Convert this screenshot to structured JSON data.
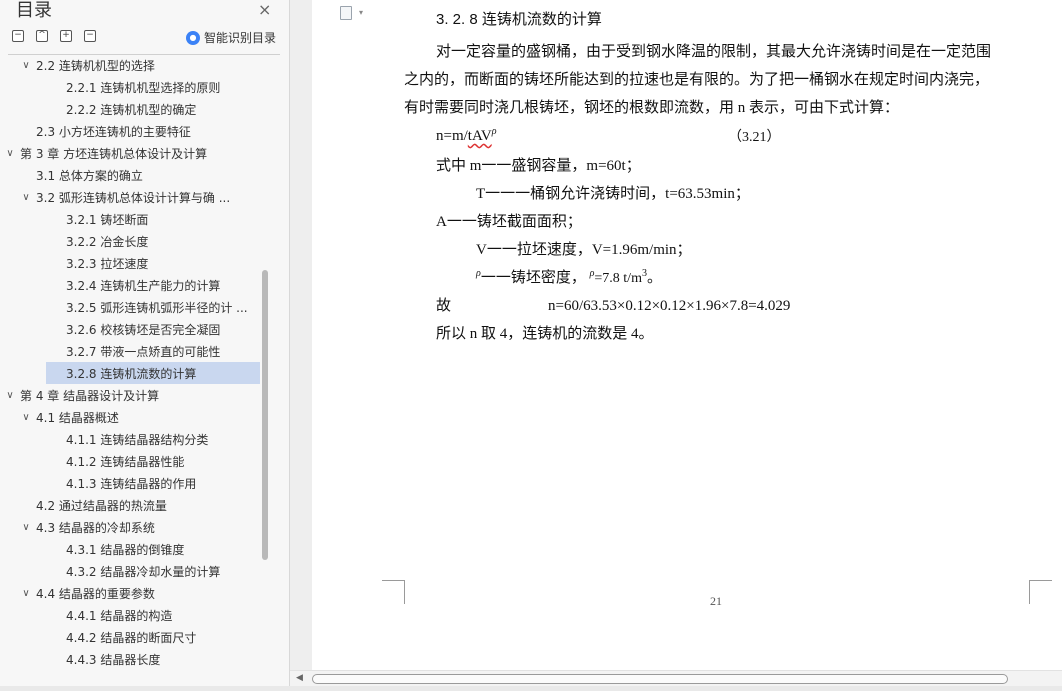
{
  "toc": {
    "title": "目录",
    "close_icon": "×",
    "toolbar": {
      "collapse_all": "−",
      "expand_up": "^",
      "add": "+",
      "remove": "−"
    },
    "smart_label": "智能识别目录",
    "items": [
      {
        "level": 2,
        "arrow": "∨",
        "label": "2.2   连铸机机型的选择"
      },
      {
        "level": 3,
        "arrow": "",
        "label": "2.2.1  连铸机机型选择的原则"
      },
      {
        "level": 3,
        "arrow": "",
        "label": "2.2.2  连铸机机型的确定"
      },
      {
        "level": 2,
        "arrow": "",
        "label": "2.3   小方坯连铸机的主要特征"
      },
      {
        "level": 1,
        "arrow": "∨",
        "label": "第 3 章   方坯连铸机总体设计及计算"
      },
      {
        "level": 2,
        "arrow": "",
        "label": "3.1   总体方案的确立"
      },
      {
        "level": 2,
        "arrow": "∨",
        "label": "3.2   弧形连铸机总体设计计算与确 ..."
      },
      {
        "level": 3,
        "arrow": "",
        "label": "3.2.1  铸坯断面"
      },
      {
        "level": 3,
        "arrow": "",
        "label": "3.2.2  冶金长度"
      },
      {
        "level": 3,
        "arrow": "",
        "label": "3.2.3  拉坯速度"
      },
      {
        "level": 3,
        "arrow": "",
        "label": "3.2.4  连铸机生产能力的计算"
      },
      {
        "level": 3,
        "arrow": "",
        "label": "3.2.5  弧形连铸机弧形半径的计 ..."
      },
      {
        "level": 3,
        "arrow": "",
        "label": "3.2.6  校核铸坯是否完全凝固"
      },
      {
        "level": 3,
        "arrow": "",
        "label": "3.2.7  带液一点矫直的可能性"
      },
      {
        "level": 3,
        "arrow": "",
        "label": "3.2.8  连铸机流数的计算",
        "selected": true
      },
      {
        "level": 1,
        "arrow": "∨",
        "label": "第 4 章   结晶器设计及计算"
      },
      {
        "level": 2,
        "arrow": "∨",
        "label": "4.1   结晶器概述"
      },
      {
        "level": 3,
        "arrow": "",
        "label": "4.1.1  连铸结晶器结构分类"
      },
      {
        "level": 3,
        "arrow": "",
        "label": "4.1.2  连铸结晶器性能"
      },
      {
        "level": 3,
        "arrow": "",
        "label": "4.1.3  连铸结晶器的作用"
      },
      {
        "level": 2,
        "arrow": "",
        "label": "4.2   通过结晶器的热流量"
      },
      {
        "level": 2,
        "arrow": "∨",
        "label": "4.3   结晶器的冷却系统"
      },
      {
        "level": 3,
        "arrow": "",
        "label": "4.3.1  结晶器的倒锥度"
      },
      {
        "level": 3,
        "arrow": "",
        "label": "4.3.2  结晶器冷却水量的计算"
      },
      {
        "level": 2,
        "arrow": "∨",
        "label": "4.4   结晶器的重要参数"
      },
      {
        "level": 3,
        "arrow": "",
        "label": "4.4.1  结晶器的构造"
      },
      {
        "level": 3,
        "arrow": "",
        "label": "4.4.2  结晶器的断面尺寸"
      },
      {
        "level": 3,
        "arrow": "",
        "label": "4.4.3  结晶器长度"
      }
    ]
  },
  "document": {
    "heading": "3. 2. 8  连铸机流数的计算",
    "paragraph": [
      "对一定容量的盛钢桶，由于受到钢水降温的限制，其最大允许浇铸时间是在一定范围",
      "之内的，而断面的铸坯所能达到的拉速也是有限的。为了把一桶钢水在规定时间内浇完，",
      "有时需要同时浇几根铸坯，钢坯的根数即流数，用 n 表示，可由下式计算："
    ],
    "formula": {
      "prefix": "n=m/",
      "underlined": "tAV",
      "rho": "ρ",
      "number": "（3.21）"
    },
    "where_m": "式中  m一一盛钢容量，m=60t；",
    "def_T": "T一一一桶钢允许浇铸时间，t=63.53min；",
    "def_A": "A一一铸坯截面面积；",
    "def_V": "V一一拉坯速度，V=1.96m/min；",
    "def_rho": {
      "symbol": "ρ",
      "text": "一一铸坯密度，",
      "value_symbol": "ρ",
      "value": "=7.8 t/m",
      "exp": "3",
      "end": "。"
    },
    "calc": {
      "label": "故",
      "expr": "n=60/63.53×0.12×0.12×1.96×7.8=4.029"
    },
    "conclusion": "所以  n 取 4，连铸机的流数是 4。",
    "page_number": "21"
  },
  "scrollbar": {
    "left_arrow": "◀"
  }
}
